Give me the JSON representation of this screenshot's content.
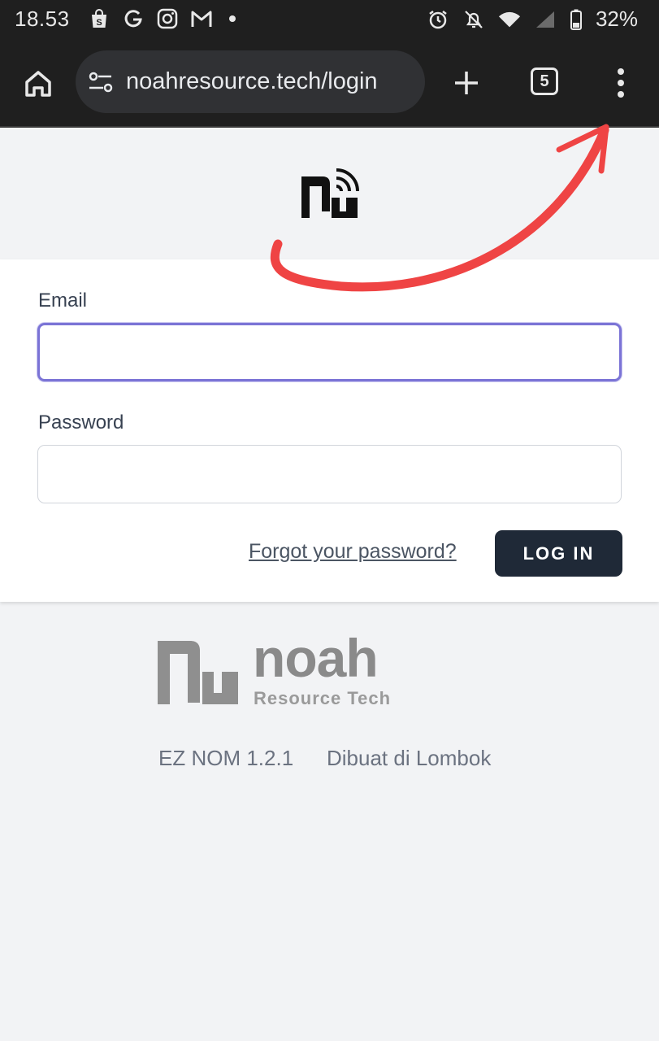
{
  "status_bar": {
    "time": "18.53",
    "left_icons": [
      "shopping-bag-icon",
      "g-icon",
      "instagram-icon",
      "gmail-icon",
      "notification-dot-icon"
    ],
    "right_icons": [
      "alarm-icon",
      "notifications-off-icon",
      "wifi-icon",
      "signal-icon",
      "battery-icon"
    ],
    "battery_percent": "32%"
  },
  "browser": {
    "url": "noahresource.tech/login",
    "tab_count": "5"
  },
  "login_form": {
    "email_label": "Email",
    "email_value": "",
    "password_label": "Password",
    "password_value": "",
    "forgot_link": "Forgot your password?",
    "login_button": "LOG IN"
  },
  "footer": {
    "brand_name": "noah",
    "brand_tagline": "Resource Tech",
    "version": "EZ NOM 1.2.1",
    "made_in": "Dibuat di Lombok"
  },
  "colors": {
    "focus_border": "#7b74d6",
    "button_bg": "#1f2937",
    "annotation_arrow": "#ef4444"
  }
}
